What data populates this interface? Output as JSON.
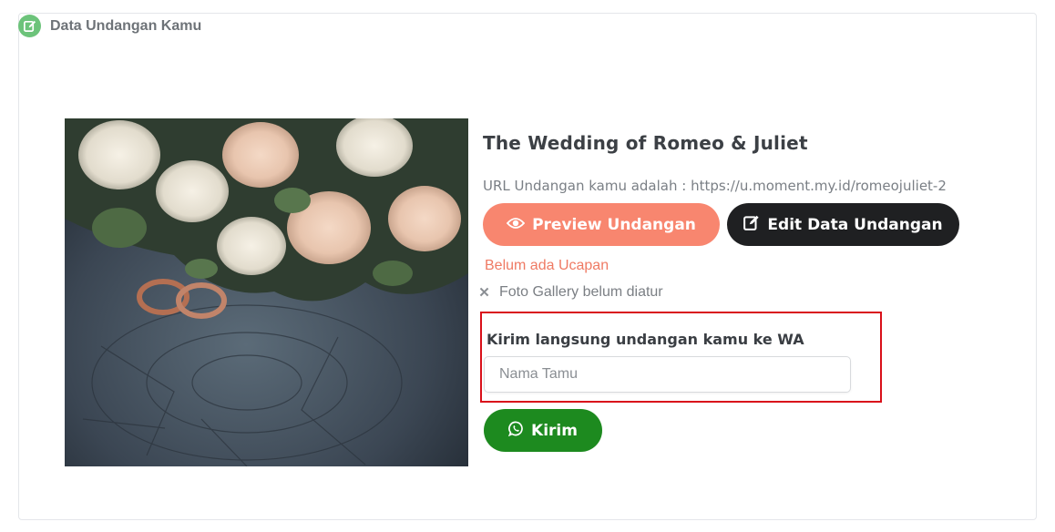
{
  "header": {
    "title": "Data Undangan Kamu",
    "icon": "edit-icon"
  },
  "invitation": {
    "title": "The Wedding of Romeo & Juliet",
    "url_text": "URL Undangan kamu adalah : https://u.moment.my.id/romeojuliet-2"
  },
  "buttons": {
    "preview_label": "Preview Undangan",
    "edit_label": "Edit Data Undangan",
    "send_label": "Kirim"
  },
  "status": {
    "ucapan": "Belum ada Ucapan",
    "gallery": "Foto Gallery belum diatur"
  },
  "wa_form": {
    "label": "Kirim langsung undangan kamu ke WA",
    "placeholder": "Nama Tamu",
    "value": ""
  },
  "colors": {
    "accent_preview": "#f8866f",
    "accent_edit": "#1f2022",
    "accent_send": "#1d8a1f",
    "status_warning": "#ef7a63",
    "highlight_border": "#d9101a",
    "header_icon": "#6cc37a"
  }
}
